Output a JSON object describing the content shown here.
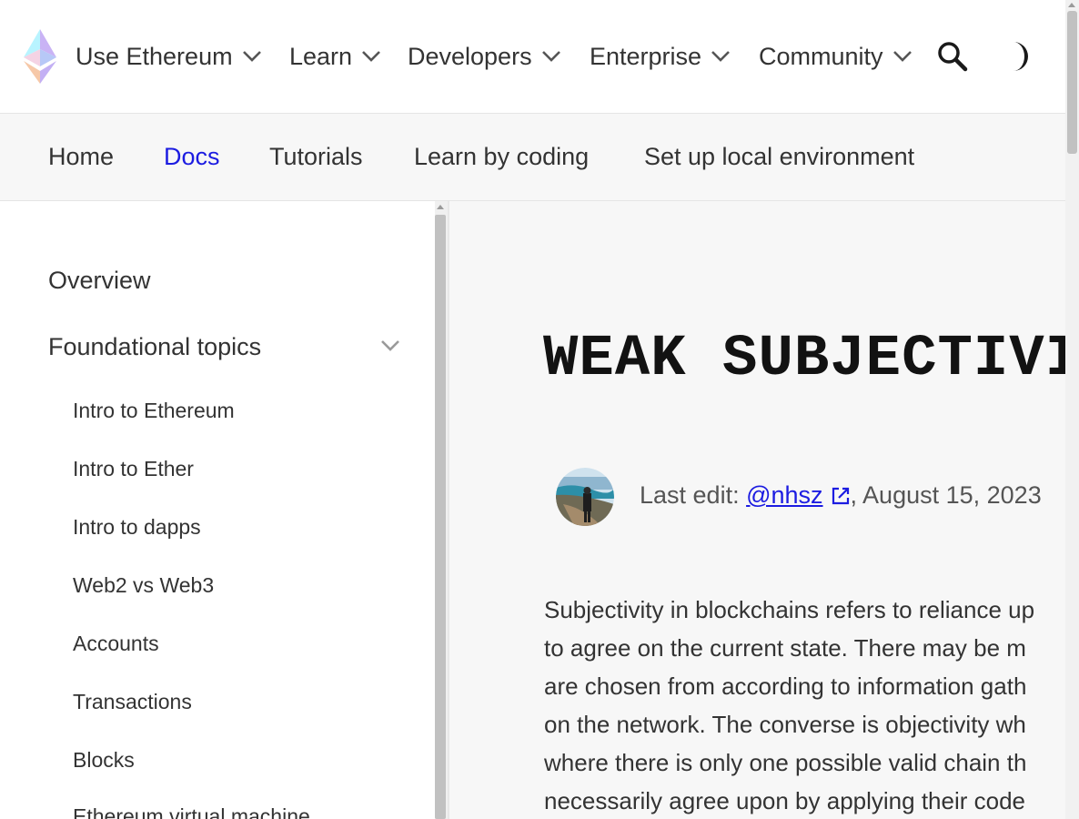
{
  "top_nav": {
    "logo_icon": "ethereum-logo-icon",
    "items": [
      {
        "label": "Use Ethereum"
      },
      {
        "label": "Learn"
      },
      {
        "label": "Developers"
      },
      {
        "label": "Enterprise"
      },
      {
        "label": "Community"
      }
    ],
    "search_icon": "search-icon",
    "theme_icon": "dark-mode-icon"
  },
  "sub_nav": {
    "items": [
      {
        "label": "Home",
        "active": false
      },
      {
        "label": "Docs",
        "active": true
      },
      {
        "label": "Tutorials",
        "active": false
      },
      {
        "label": "Learn by coding",
        "active": false
      },
      {
        "label": "Set up local environment",
        "active": false
      }
    ]
  },
  "sidebar": {
    "overview": "Overview",
    "section": "Foundational topics",
    "links": [
      "Intro to Ethereum",
      "Intro to Ether",
      "Intro to dapps",
      "Web2 vs Web3",
      "Accounts",
      "Transactions",
      "Blocks",
      "Ethereum virtual machine"
    ]
  },
  "main": {
    "title": "WEAK SUBJECTIVI",
    "last_edit_label": "Last edit: ",
    "last_edit_user": "@nhsz",
    "last_edit_date": ", August 15, 2023",
    "body_lines": [
      "Subjectivity in blockchains refers to reliance up",
      "to agree on the current state. There may be m",
      "are chosen from according to information gath",
      "on the network. The converse is objectivity wh",
      "where there is only one possible valid chain th",
      "necessarily agree upon by applying their code"
    ]
  },
  "colors": {
    "accent": "#1c1ce1",
    "text": "#333333",
    "background": "#f7f7f7"
  }
}
